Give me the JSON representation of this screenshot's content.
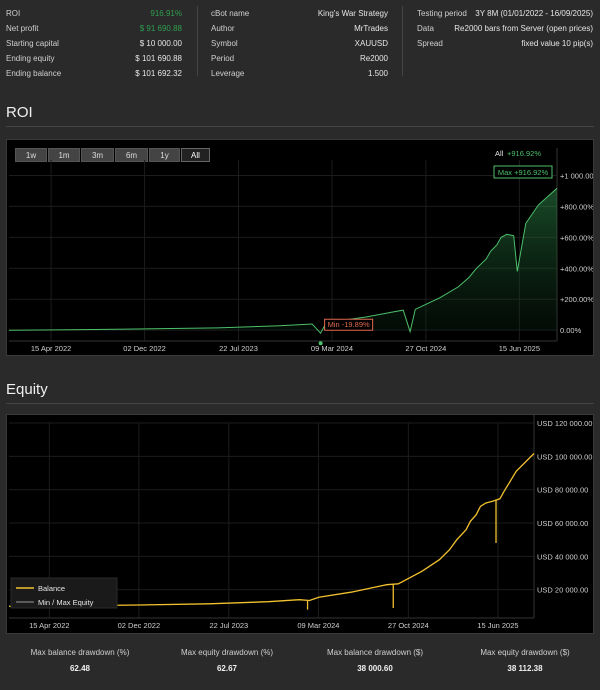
{
  "info": {
    "col1": [
      {
        "label": "ROI",
        "value": "916.91%",
        "green": true
      },
      {
        "label": "Net profit",
        "value": "$ 91 690.88",
        "green": true
      },
      {
        "label": "Starting capital",
        "value": "$ 10 000.00"
      },
      {
        "label": "Ending equity",
        "value": "$ 101 690.88"
      },
      {
        "label": "Ending balance",
        "value": "$ 101 692.32"
      }
    ],
    "col2": [
      {
        "label": "cBot name",
        "value": "King's War Strategy"
      },
      {
        "label": "Author",
        "value": "MrTrades"
      },
      {
        "label": "Symbol",
        "value": "XAUUSD"
      },
      {
        "label": "Period",
        "value": "Re2000"
      },
      {
        "label": "Leverage",
        "value": "1.500"
      }
    ],
    "col3": [
      {
        "label": "Testing period",
        "value": "3Y 8M (01/01/2022 - 16/09/2025)"
      },
      {
        "label": "Data",
        "value": "Re2000 bars from Server (open prices)"
      },
      {
        "label": "Spread",
        "value": "fixed value 10 pip(s)"
      }
    ]
  },
  "roi_section": {
    "title": "ROI",
    "buttons": [
      "1w",
      "1m",
      "3m",
      "6m",
      "1y",
      "All"
    ],
    "active_button": "All",
    "summary_label": "All",
    "summary_value": "+916.92%",
    "max_label": "Max +916.92%",
    "min_label": "Min -19.89%"
  },
  "equity_section": {
    "title": "Equity",
    "legend": [
      "Balance",
      "Min / Max Equity"
    ]
  },
  "colors": {
    "roi_line": "#4cc06a",
    "balance": "#f2c12e",
    "min_label": "#e06a50",
    "max_label": "#4cc06a"
  },
  "stats": [
    {
      "label": "Max balance drawdown (%)",
      "value": "62.48"
    },
    {
      "label": "Max equity drawdown (%)",
      "value": "62.67"
    },
    {
      "label": "Max balance drawdown ($)",
      "value": "38 000.60"
    },
    {
      "label": "Max equity drawdown ($)",
      "value": "38 112.38"
    }
  ],
  "chart_data": [
    {
      "type": "area",
      "title": "ROI",
      "xlabel": "",
      "ylabel": "",
      "x_tick_labels": [
        "15 Apr 2022",
        "02 Dec 2022",
        "22 Jul 2023",
        "09 Mar 2024",
        "27 Oct 2024",
        "15 Jun 2025"
      ],
      "y_tick_labels": [
        "0.00%",
        "+200.00%",
        "+400.00%",
        "+600.00%",
        "+800.00%",
        "+1 000.00%"
      ],
      "ylim": [
        -70,
        1100
      ],
      "grid": true,
      "series": [
        {
          "x": [
            "2022-01-01",
            "2022-06-01",
            "2022-12-01",
            "2023-06-01",
            "2023-11-01",
            "2024-01-20",
            "2024-02-10",
            "2024-02-20",
            "2024-03-10",
            "2024-06-01",
            "2024-08-01",
            "2024-09-01",
            "2024-09-18",
            "2024-10-01",
            "2024-12-01",
            "2025-01-15",
            "2025-02-10",
            "2025-03-01",
            "2025-03-25",
            "2025-04-05",
            "2025-04-20",
            "2025-05-01",
            "2025-05-15",
            "2025-06-01",
            "2025-06-10",
            "2025-07-01",
            "2025-08-01",
            "2025-09-16"
          ],
          "y": [
            0,
            3,
            8,
            15,
            28,
            40,
            -19.89,
            30,
            55,
            85,
            115,
            130,
            -10,
            135,
            210,
            280,
            340,
            400,
            460,
            510,
            550,
            600,
            620,
            610,
            380,
            690,
            810,
            916.92
          ]
        }
      ]
    },
    {
      "type": "line",
      "title": "Equity",
      "xlabel": "",
      "ylabel": "",
      "x_tick_labels": [
        "15 Apr 2022",
        "02 Dec 2022",
        "22 Jul 2023",
        "09 Mar 2024",
        "27 Oct 2024",
        "15 Jun 2025"
      ],
      "y_tick_labels": [
        "USD 20 000.00",
        "USD 40 000.00",
        "USD 60 000.00",
        "USD 80 000.00",
        "USD 100 000.00",
        "USD 120 000.00"
      ],
      "ylim": [
        3000,
        120000
      ],
      "grid": true,
      "legend_position": "bottom-left",
      "series": [
        {
          "name": "Balance",
          "x": [
            "2022-01-01",
            "2022-06-01",
            "2022-12-01",
            "2023-06-01",
            "2023-11-01",
            "2024-01-20",
            "2024-02-15",
            "2024-03-10",
            "2024-06-01",
            "2024-08-01",
            "2024-09-01",
            "2024-10-01",
            "2024-12-01",
            "2025-01-15",
            "2025-02-10",
            "2025-03-01",
            "2025-03-25",
            "2025-04-05",
            "2025-04-20",
            "2025-05-01",
            "2025-05-15",
            "2025-06-01",
            "2025-06-20",
            "2025-07-01",
            "2025-08-01",
            "2025-09-16"
          ],
          "y": [
            10000,
            10300,
            10800,
            11500,
            12800,
            14000,
            13500,
            15500,
            18500,
            21500,
            23000,
            23500,
            31000,
            38000,
            44000,
            50000,
            56000,
            61000,
            65000,
            70000,
            72000,
            73000,
            74500,
            79000,
            91000,
            101692.32
          ]
        },
        {
          "name": "Min / Max Equity",
          "x": [
            "2024-02-10",
            "2024-09-18",
            "2025-06-10"
          ],
          "y": [
            8011,
            9000,
            48000
          ]
        }
      ]
    }
  ]
}
